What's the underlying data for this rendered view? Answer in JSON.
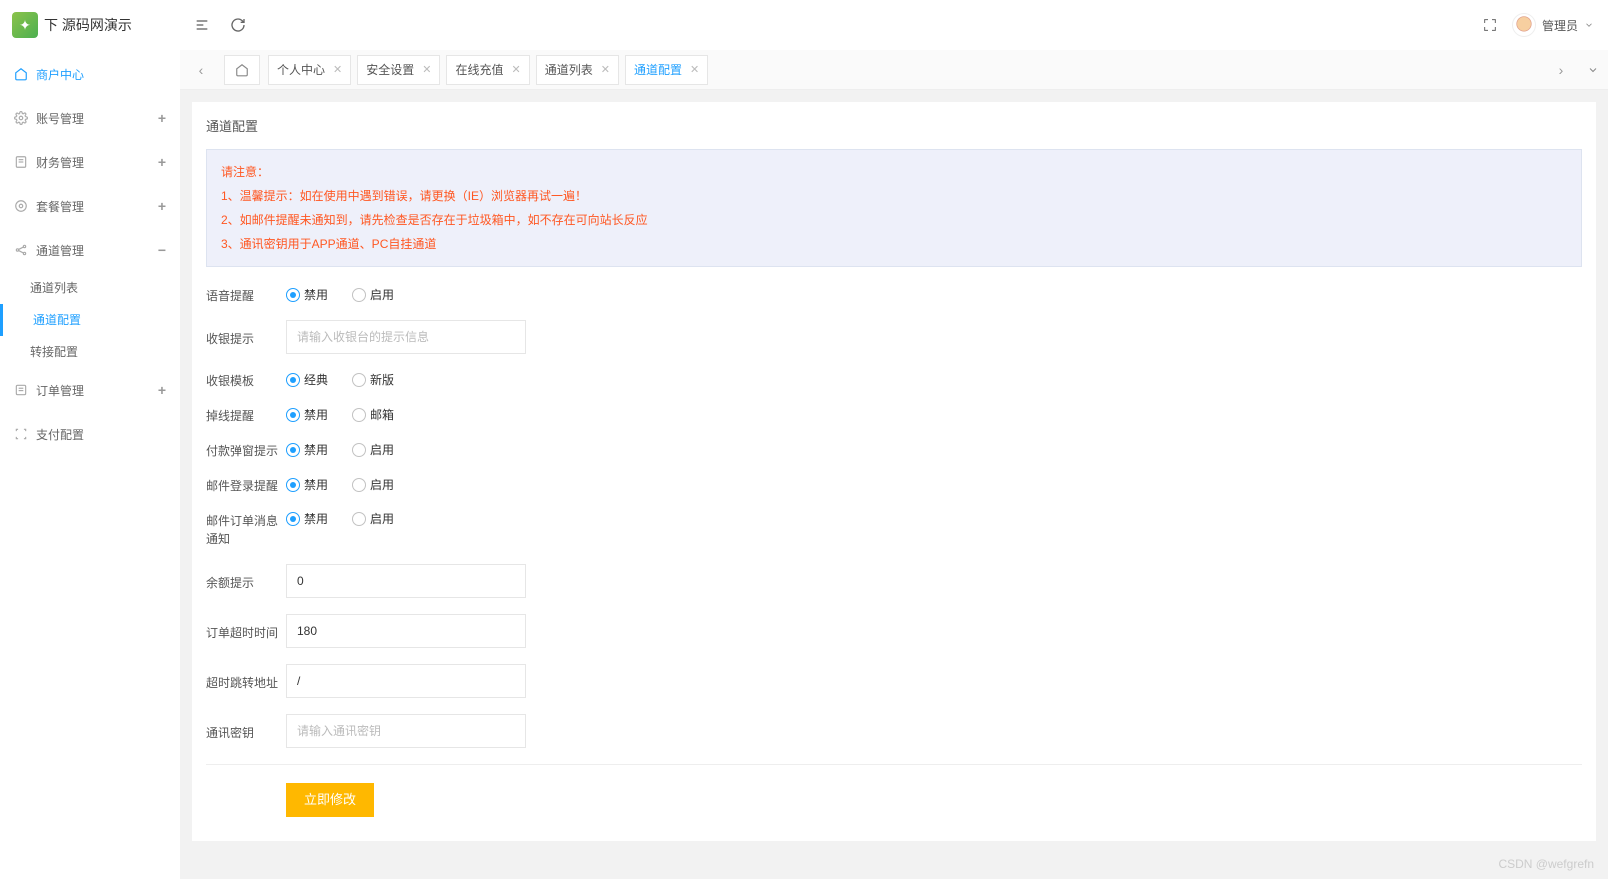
{
  "logo": {
    "text": "下 源码网演示"
  },
  "header": {
    "user_label": "管理员"
  },
  "sidebar": {
    "items": [
      {
        "label": "商户中心",
        "icon": "home",
        "active": true,
        "expand": ""
      },
      {
        "label": "账号管理",
        "icon": "gear",
        "expand": "+"
      },
      {
        "label": "财务管理",
        "icon": "doc",
        "expand": "+"
      },
      {
        "label": "套餐管理",
        "icon": "gear2",
        "expand": "+"
      },
      {
        "label": "通道管理",
        "icon": "share",
        "expand": "−",
        "children": [
          {
            "label": "通道列表"
          },
          {
            "label": "通道配置",
            "active": true
          },
          {
            "label": "转接配置"
          }
        ]
      },
      {
        "label": "订单管理",
        "icon": "list",
        "expand": "+"
      },
      {
        "label": "支付配置",
        "icon": "scan",
        "expand": ""
      }
    ]
  },
  "tabs": [
    {
      "label": "个人中心"
    },
    {
      "label": "安全设置"
    },
    {
      "label": "在线充值"
    },
    {
      "label": "通道列表"
    },
    {
      "label": "通道配置",
      "active": true
    }
  ],
  "panel": {
    "title": "通道配置"
  },
  "notice": {
    "head": "请注意：",
    "l1": "1、温馨提示：如在使用中遇到错误，请更换（IE）浏览器再试一遍！",
    "l2": "2、如邮件提醒未通知到，请先检查是否存在于垃圾箱中，如不存在可向站长反应",
    "l3": "3、通讯密钥用于APP通道、PC自挂通道"
  },
  "form": {
    "voice": {
      "label": "语音提醒",
      "opt1": "禁用",
      "opt2": "启用"
    },
    "cashier": {
      "label": "收银提示",
      "placeholder": "请输入收银台的提示信息"
    },
    "template": {
      "label": "收银模板",
      "opt1": "经典",
      "opt2": "新版"
    },
    "offline": {
      "label": "掉线提醒",
      "opt1": "禁用",
      "opt2": "邮箱"
    },
    "popup": {
      "label": "付款弹窗提示",
      "opt1": "禁用",
      "opt2": "启用"
    },
    "maillog": {
      "label": "邮件登录提醒",
      "opt1": "禁用",
      "opt2": "启用"
    },
    "mailord": {
      "label": "邮件订单消息通知",
      "opt1": "禁用",
      "opt2": "启用"
    },
    "balance": {
      "label": "余额提示",
      "value": "0"
    },
    "timeout": {
      "label": "订单超时时间",
      "value": "180"
    },
    "redirect": {
      "label": "超时跳转地址",
      "value": "/"
    },
    "secret": {
      "label": "通讯密钥",
      "placeholder": "请输入通讯密钥"
    }
  },
  "submit": "立即修改",
  "watermark": "CSDN @wefgrefn"
}
